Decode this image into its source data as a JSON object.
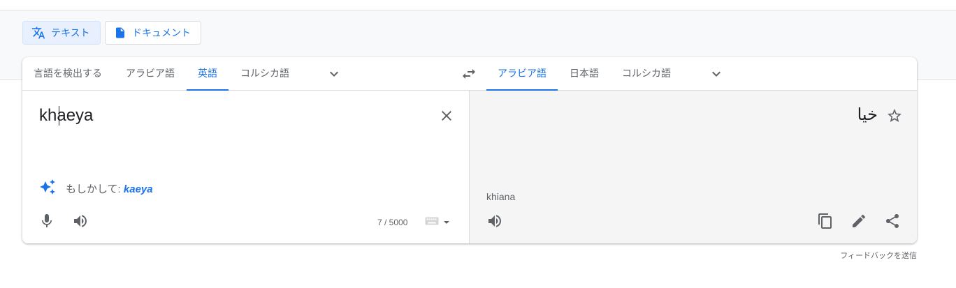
{
  "modes": {
    "text_label": "テキスト",
    "document_label": "ドキュメント"
  },
  "source_languages": [
    {
      "label": "言語を検出する",
      "active": false
    },
    {
      "label": "アラビア語",
      "active": false
    },
    {
      "label": "英語",
      "active": true
    },
    {
      "label": "コルシカ語",
      "active": false
    }
  ],
  "target_languages": [
    {
      "label": "アラビア語",
      "active": true
    },
    {
      "label": "日本語",
      "active": false
    },
    {
      "label": "コルシカ語",
      "active": false
    }
  ],
  "source": {
    "input_text": "khaeya",
    "suggestion_prefix": "もしかして:",
    "suggestion_term": "kaeya",
    "char_count": "7 / 5000"
  },
  "target": {
    "translation": "خيا",
    "transliteration": "khiana"
  },
  "feedback_link": "フィードバックを送信",
  "colors": {
    "accent": "#1a73e8",
    "icon_gray": "#5f6368",
    "target_bg": "#f5f5f5"
  },
  "icons": [
    "translate-icon",
    "document-icon",
    "chevron-down-icon",
    "swap-icon",
    "close-icon",
    "sparkle-icon",
    "mic-icon",
    "speaker-icon",
    "keyboard-icon",
    "star-icon",
    "copy-icon",
    "edit-icon",
    "share-icon"
  ]
}
